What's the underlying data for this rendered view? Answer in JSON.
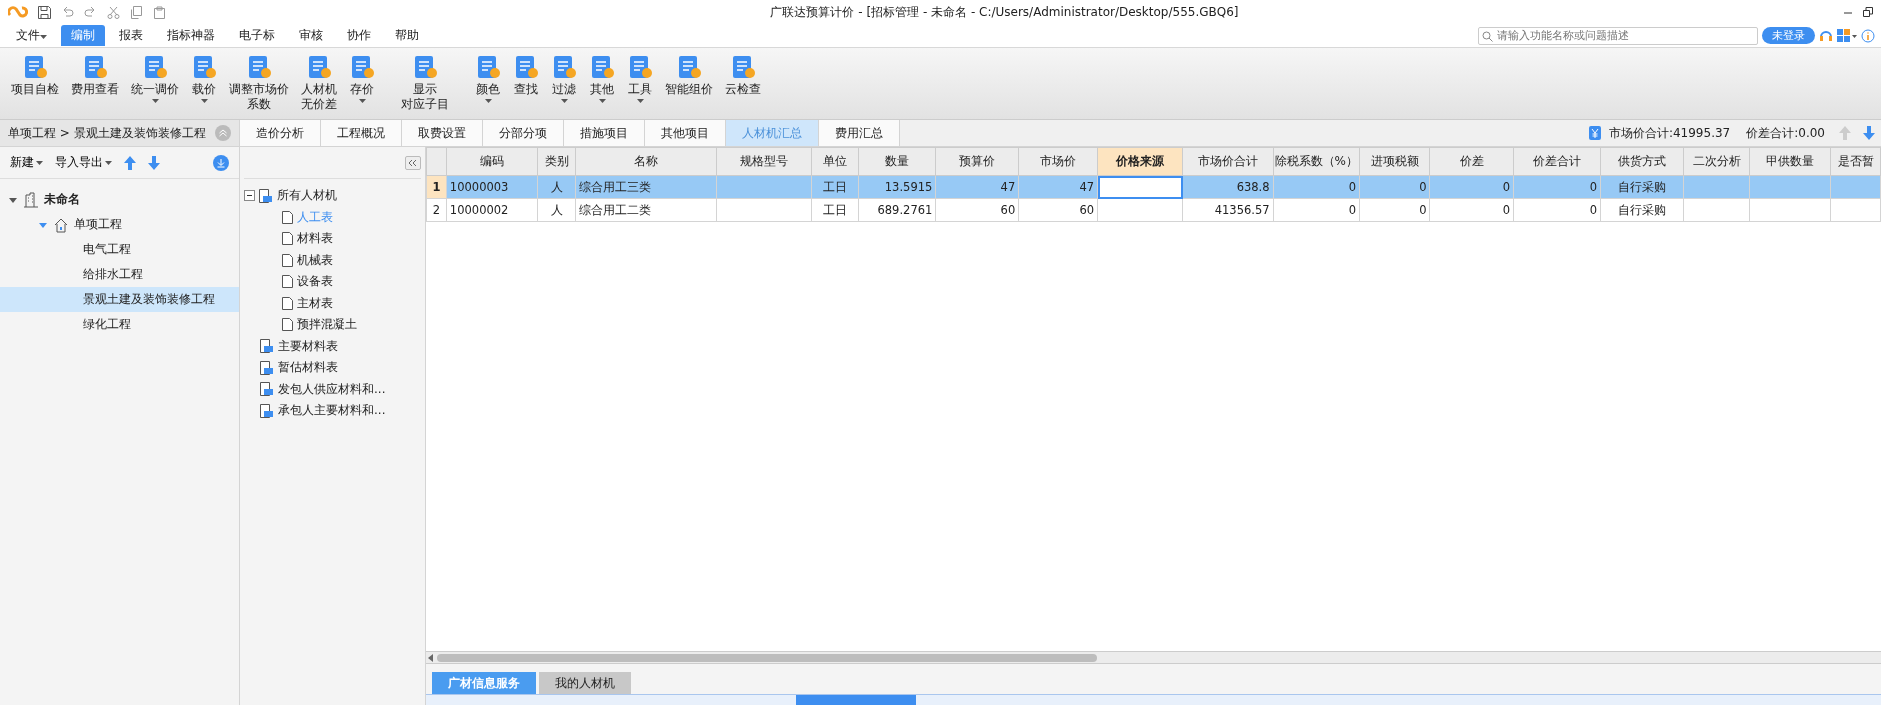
{
  "window": {
    "title": "广联达预算计价 - [招标管理 - 未命名 - C:/Users/Administrator/Desktop/555.GBQ6]"
  },
  "menu": [
    {
      "label": "文件",
      "has_menu": true,
      "selected": false
    },
    {
      "label": "编制",
      "has_menu": false,
      "selected": true
    },
    {
      "label": "报表",
      "has_menu": false,
      "selected": false
    },
    {
      "label": "指标神器",
      "has_menu": false,
      "selected": false
    },
    {
      "label": "电子标",
      "has_menu": false,
      "selected": false
    },
    {
      "label": "审核",
      "has_menu": false,
      "selected": false
    },
    {
      "label": "协作",
      "has_menu": false,
      "selected": false
    },
    {
      "label": "帮助",
      "has_menu": false,
      "selected": false
    }
  ],
  "search": {
    "placeholder": "请输入功能名称或问题描述"
  },
  "login_button": "未登录",
  "ribbon": [
    {
      "label": "项目自检",
      "has_menu": false
    },
    {
      "label": "费用查看",
      "has_menu": false
    },
    {
      "label": "统一调价",
      "has_menu": true
    },
    {
      "label": "载价",
      "has_menu": true
    },
    {
      "label": "调整市场价",
      "label_line2": "系数",
      "has_menu": false
    },
    {
      "label": "人材机",
      "label_line2": "无价差",
      "has_menu": false
    },
    {
      "label": "存价",
      "has_menu": true
    },
    {
      "label": "显示",
      "label_line2": "对应子目",
      "has_menu": false
    },
    {
      "label": "颜色",
      "has_menu": true
    },
    {
      "label": "查找",
      "has_menu": false
    },
    {
      "label": "过滤",
      "has_menu": true
    },
    {
      "label": "其他",
      "has_menu": true
    },
    {
      "label": "工具",
      "has_menu": true
    },
    {
      "label": "智能组价",
      "has_menu": false
    },
    {
      "label": "云检查",
      "has_menu": false
    }
  ],
  "breadcrumb": "单项工程 > 景观土建及装饰装修工程",
  "project_toolbar": [
    {
      "label": "新建"
    },
    {
      "label": "导入导出"
    }
  ],
  "project_tree": [
    {
      "label": "未命名",
      "selected": false,
      "expanded": true,
      "children": [
        {
          "label": "单项工程",
          "selected": false,
          "expanded": true,
          "children": [
            {
              "label": "电气工程",
              "selected": false
            },
            {
              "label": "给排水工程",
              "selected": false
            },
            {
              "label": "景观土建及装饰装修工程",
              "selected": true
            },
            {
              "label": "绿化工程",
              "selected": false
            }
          ]
        }
      ]
    }
  ],
  "tabs": [
    {
      "label": "造价分析",
      "selected": false
    },
    {
      "label": "工程概况",
      "selected": false
    },
    {
      "label": "取费设置",
      "selected": false
    },
    {
      "label": "分部分项",
      "selected": false
    },
    {
      "label": "措施项目",
      "selected": false
    },
    {
      "label": "其他项目",
      "selected": false
    },
    {
      "label": "人材机汇总",
      "selected": true
    },
    {
      "label": "费用汇总",
      "selected": false
    }
  ],
  "summary": [
    "市场价合计:41995.37",
    "价差合计:0.00"
  ],
  "category_tree": [
    {
      "label": "所有人材机",
      "kind": "group",
      "selected": false,
      "expanded": true,
      "children": [
        {
          "label": "人工表",
          "kind": "sheet",
          "selected": true
        },
        {
          "label": "材料表",
          "kind": "sheet",
          "selected": false
        },
        {
          "label": "机械表",
          "kind": "sheet",
          "selected": false
        },
        {
          "label": "设备表",
          "kind": "sheet",
          "selected": false
        },
        {
          "label": "主材表",
          "kind": "sheet",
          "selected": false
        },
        {
          "label": "预拌混凝土",
          "kind": "sheet",
          "selected": false
        }
      ]
    },
    {
      "label": "主要材料表",
      "kind": "group",
      "selected": false
    },
    {
      "label": "暂估材料表",
      "kind": "group",
      "selected": false
    },
    {
      "label": "发包人供应材料和...",
      "kind": "group",
      "selected": false
    },
    {
      "label": "承包人主要材料和...",
      "kind": "group",
      "selected": false
    }
  ],
  "table": {
    "columns": [
      {
        "label": "编码",
        "kind": "left",
        "active": false
      },
      {
        "label": "类别",
        "kind": "center",
        "active": false
      },
      {
        "label": "名称",
        "kind": "left",
        "active": false
      },
      {
        "label": "规格型号",
        "kind": "left",
        "active": false
      },
      {
        "label": "单位",
        "kind": "center",
        "active": false
      },
      {
        "label": "数量",
        "kind": "number",
        "active": false
      },
      {
        "label": "预算价",
        "kind": "number",
        "active": false
      },
      {
        "label": "市场价",
        "kind": "number",
        "active": false
      },
      {
        "label": "价格来源",
        "kind": "left",
        "active": true
      },
      {
        "label": "市场价合计",
        "kind": "number",
        "active": false
      },
      {
        "label": "除税系数（%）",
        "kind": "number",
        "active": false
      },
      {
        "label": "进项税额",
        "kind": "number",
        "active": false
      },
      {
        "label": "价差",
        "kind": "number",
        "active": false
      },
      {
        "label": "价差合计",
        "kind": "number",
        "active": false
      },
      {
        "label": "供货方式",
        "kind": "center",
        "active": false
      },
      {
        "label": "二次分析",
        "kind": "left",
        "active": false
      },
      {
        "label": "甲供数量",
        "kind": "left",
        "active": false
      },
      {
        "label": "是否暂",
        "kind": "left",
        "active": false
      }
    ],
    "rows": [
      {
        "index": "1",
        "selected": true,
        "cells": [
          "10000003",
          "人",
          "综合用工三类",
          "",
          "工日",
          "13.5915",
          "47",
          "47",
          "",
          "638.8",
          "0",
          "0",
          "0",
          "0",
          "自行采购",
          "",
          "",
          ""
        ]
      },
      {
        "index": "2",
        "selected": false,
        "cells": [
          "10000002",
          "人",
          "综合用工二类",
          "",
          "工日",
          "689.2761",
          "60",
          "60",
          "",
          "41356.57",
          "0",
          "0",
          "0",
          "0",
          "自行采购",
          "",
          "",
          ""
        ]
      }
    ]
  },
  "bottom_tabs": [
    {
      "label": "广材信息服务",
      "selected": true
    },
    {
      "label": "我的人材机",
      "selected": false
    }
  ]
}
